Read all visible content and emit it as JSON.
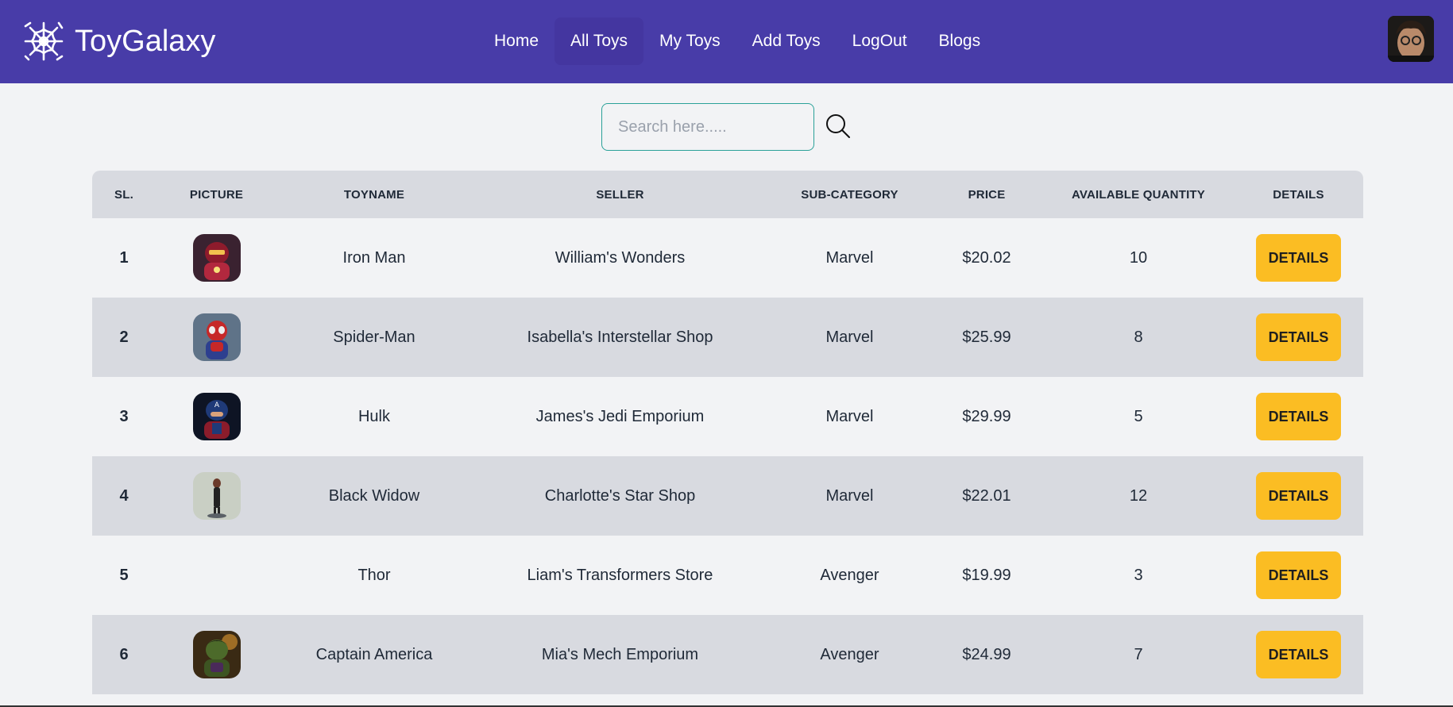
{
  "brand": {
    "name": "ToyGalaxy"
  },
  "nav": {
    "items": [
      {
        "label": "Home"
      },
      {
        "label": "All Toys"
      },
      {
        "label": "My Toys"
      },
      {
        "label": "Add Toys"
      },
      {
        "label": "LogOut"
      },
      {
        "label": "Blogs"
      }
    ],
    "active": "All Toys"
  },
  "search": {
    "placeholder": "Search here.....",
    "value": ""
  },
  "table": {
    "headers": [
      "SL.",
      "PICTURE",
      "TOYNAME",
      "SELLER",
      "SUB-CATEGORY",
      "PRICE",
      "AVAILABLE QUANTITY",
      "DETAILS"
    ],
    "rows": [
      {
        "sl": "1",
        "picture": "iron-man-thumbnail",
        "toyname": "Iron Man",
        "seller": "William's Wonders",
        "subcategory": "Marvel",
        "price": "$20.02",
        "quantity": "10",
        "details": "DETAILS"
      },
      {
        "sl": "2",
        "picture": "spider-man-thumbnail",
        "toyname": "Spider-Man",
        "seller": "Isabella's Interstellar Shop",
        "subcategory": "Marvel",
        "price": "$25.99",
        "quantity": "8",
        "details": "DETAILS"
      },
      {
        "sl": "3",
        "picture": "captain-figure-thumbnail",
        "toyname": "Hulk",
        "seller": "James's Jedi Emporium",
        "subcategory": "Marvel",
        "price": "$29.99",
        "quantity": "5",
        "details": "DETAILS"
      },
      {
        "sl": "4",
        "picture": "black-widow-thumbnail",
        "toyname": "Black Widow",
        "seller": "Charlotte's Star Shop",
        "subcategory": "Marvel",
        "price": "$22.01",
        "quantity": "12",
        "details": "DETAILS"
      },
      {
        "sl": "5",
        "picture": "",
        "toyname": "Thor",
        "seller": "Liam's Transformers Store",
        "subcategory": "Avenger",
        "price": "$19.99",
        "quantity": "3",
        "details": "DETAILS"
      },
      {
        "sl": "6",
        "picture": "hulk-thumbnail",
        "toyname": "Captain America",
        "seller": "Mia's Mech Emporium",
        "subcategory": "Avenger",
        "price": "$24.99",
        "quantity": "7",
        "details": "DETAILS"
      }
    ]
  },
  "colors": {
    "navbar": "#483ca8",
    "page_background": "#f2f3f5",
    "row_alt": "#d8dae0",
    "details_button": "#fbbd23",
    "search_border": "#2aa198"
  },
  "icons": {
    "brand": "spider-web-logo-icon",
    "search": "search-icon",
    "avatar": "user-avatar"
  }
}
